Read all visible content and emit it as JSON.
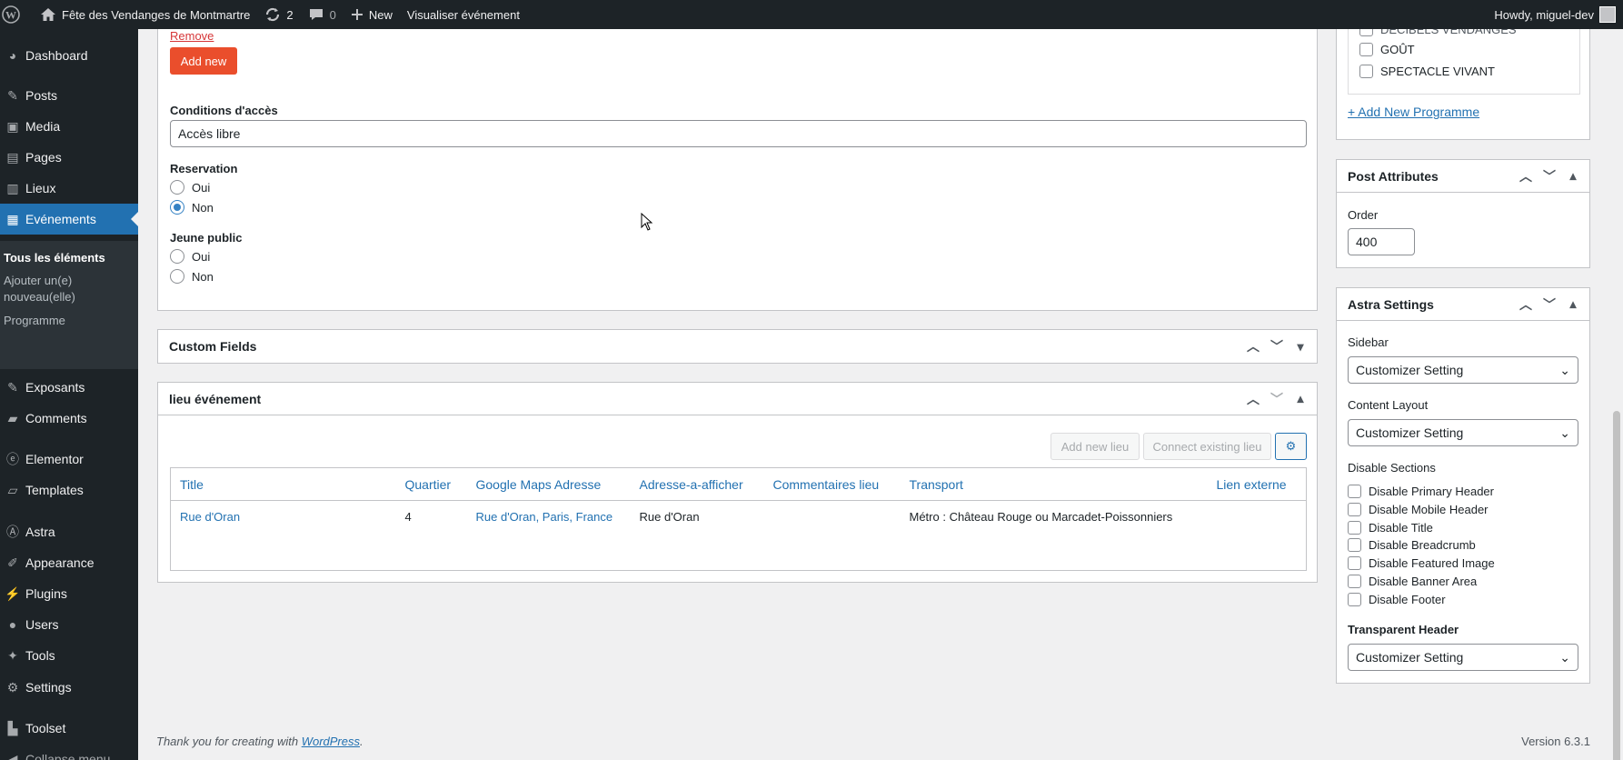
{
  "adminbar": {
    "site_name": "Fête des Vendanges de Montmartre",
    "updates_count": "2",
    "comments_count": "0",
    "new_label": "New",
    "view_label": "Visualiser événement",
    "howdy": "Howdy, miguel-dev"
  },
  "sidebar": {
    "items": [
      {
        "label": "Dashboard",
        "icon": "dashboard-icon"
      },
      {
        "label": "Posts",
        "icon": "pin-icon"
      },
      {
        "label": "Media",
        "icon": "media-icon"
      },
      {
        "label": "Pages",
        "icon": "pages-icon"
      },
      {
        "label": "Lieux",
        "icon": "building-icon"
      },
      {
        "label": "Evénements",
        "icon": "grid-icon"
      },
      {
        "label": "Exposants",
        "icon": "pin-icon"
      },
      {
        "label": "Comments",
        "icon": "comment-icon"
      },
      {
        "label": "Elementor",
        "icon": "elementor-icon"
      },
      {
        "label": "Templates",
        "icon": "folder-icon"
      },
      {
        "label": "Astra",
        "icon": "astra-icon"
      },
      {
        "label": "Appearance",
        "icon": "brush-icon"
      },
      {
        "label": "Plugins",
        "icon": "plug-icon"
      },
      {
        "label": "Users",
        "icon": "user-icon"
      },
      {
        "label": "Tools",
        "icon": "wrench-icon"
      },
      {
        "label": "Settings",
        "icon": "settings-icon"
      },
      {
        "label": "Toolset",
        "icon": "toolset-icon"
      }
    ],
    "submenu": [
      "Tous les éléments",
      "Ajouter un(e) nouveau(elle)",
      "Programme"
    ],
    "collapse_label": "Collapse menu"
  },
  "main": {
    "remove_label": "Remove",
    "add_new_label": "Add new",
    "conditions_label": "Conditions d'accès",
    "conditions_value": "Accès libre",
    "reservation_label": "Reservation",
    "reservation_options": [
      "Oui",
      "Non"
    ],
    "jeune_label": "Jeune public",
    "jeune_options": [
      "Oui",
      "Non"
    ],
    "custom_fields_title": "Custom Fields",
    "lieu_title": "lieu événement",
    "add_new_lieu": "Add new lieu",
    "connect_existing_lieu": "Connect existing lieu",
    "table": {
      "headers": [
        "Title",
        "Quartier",
        "Google Maps Adresse",
        "Adresse-a-afficher",
        "Commentaires lieu",
        "Transport",
        "Lien externe"
      ],
      "rows": [
        [
          "Rue d'Oran",
          "4",
          "Rue d'Oran, Paris, France",
          "Rue d'Oran",
          "",
          "Métro : Château Rouge ou Marcadet-Poissonniers",
          ""
        ]
      ]
    }
  },
  "right": {
    "programme_items": [
      "DÉCIBELS VENDANGES",
      "GOÛT",
      "SPECTACLE VIVANT"
    ],
    "add_programme": "+ Add New Programme",
    "post_attributes_title": "Post Attributes",
    "order_label": "Order",
    "order_value": "400",
    "astra_title": "Astra Settings",
    "sidebar_label": "Sidebar",
    "sidebar_value": "Customizer Setting",
    "content_layout_label": "Content Layout",
    "content_layout_value": "Customizer Setting",
    "disable_sections_label": "Disable Sections",
    "disable_options": [
      "Disable Primary Header",
      "Disable Mobile Header",
      "Disable Title",
      "Disable Breadcrumb",
      "Disable Featured Image",
      "Disable Banner Area",
      "Disable Footer"
    ],
    "transparent_header_label": "Transparent Header",
    "transparent_header_value": "Customizer Setting"
  },
  "footer": {
    "thanks_prefix": "Thank you for creating with ",
    "wordpress_link": "WordPress",
    "thanks_suffix": ".",
    "version": "Version 6.3.1"
  }
}
